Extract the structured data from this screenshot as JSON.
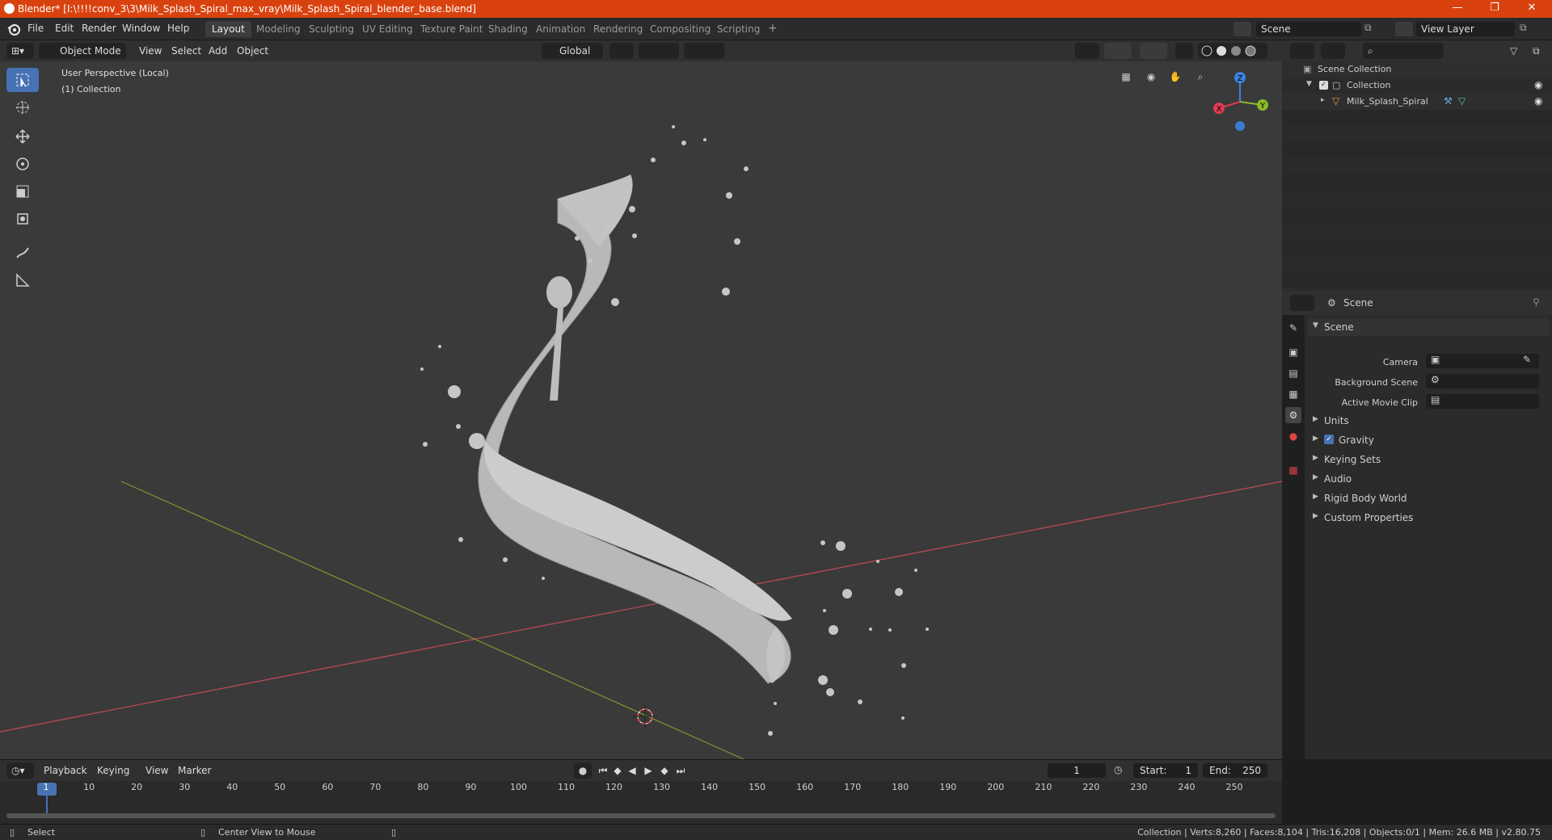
{
  "titlebar": {
    "title": "Blender* [I:\\!!!!conv_3\\3\\Milk_Splash_Spiral_max_vray\\Milk_Splash_Spiral_blender_base.blend]",
    "minimize": "—",
    "restore": "❐",
    "close": "✕"
  },
  "menu": {
    "items": [
      "File",
      "Edit",
      "Render",
      "Window",
      "Help"
    ]
  },
  "workspaces": [
    "Layout",
    "Modeling",
    "Sculpting",
    "UV Editing",
    "Texture Paint",
    "Shading",
    "Animation",
    "Rendering",
    "Compositing",
    "Scripting"
  ],
  "active_workspace": "Layout",
  "add_workspace": "+",
  "scene_field": "Scene",
  "view_layer_field": "View Layer",
  "viewport_header": {
    "mode": "Object Mode",
    "menus": [
      "View",
      "Select",
      "Add",
      "Object"
    ],
    "transform_orientation": "Global"
  },
  "viewport": {
    "perspective_label": "User Perspective (Local)",
    "collection_label": "(1) Collection",
    "gizmo_axes": {
      "x": "X",
      "y": "Y",
      "z": "Z"
    }
  },
  "outliner": {
    "root": "Scene Collection",
    "items": [
      {
        "label": "Collection"
      },
      {
        "label": "Milk_Splash_Spiral"
      }
    ]
  },
  "properties": {
    "header": "Scene",
    "section": "Scene",
    "camera_label": "Camera",
    "background_scene_label": "Background Scene",
    "active_movie_clip_label": "Active Movie Clip",
    "subpanels": [
      "Units",
      "Gravity",
      "Keying Sets",
      "Audio",
      "Rigid Body World",
      "Custom Properties"
    ],
    "gravity_checked": true
  },
  "timeline": {
    "menus": [
      "Playback",
      "Keying",
      "View",
      "Marker"
    ],
    "current_frame": "1",
    "start_label": "Start:",
    "start_value": "1",
    "end_label": "End:",
    "end_value": "250",
    "ticks": [
      "1",
      "10",
      "20",
      "30",
      "40",
      "50",
      "60",
      "70",
      "80",
      "90",
      "100",
      "110",
      "120",
      "130",
      "140",
      "150",
      "160",
      "170",
      "180",
      "190",
      "200",
      "210",
      "220",
      "230",
      "240",
      "250"
    ]
  },
  "statusbar": {
    "select": "Select",
    "center_view": "Center View to Mouse",
    "stats": "Collection | Verts:8,260 | Faces:8,104 | Tris:16,208 | Objects:0/1 | Mem: 26.6 MB | v2.80.75"
  },
  "colors": {
    "titlebar": "#d9420f",
    "accent_blue": "#4772b3",
    "axis_x": "#e03a4f",
    "axis_y": "#8ab92a",
    "axis_z": "#3b83e0",
    "viewport_bg": "#3a3a3a",
    "mesh": "#b8b8b8"
  }
}
